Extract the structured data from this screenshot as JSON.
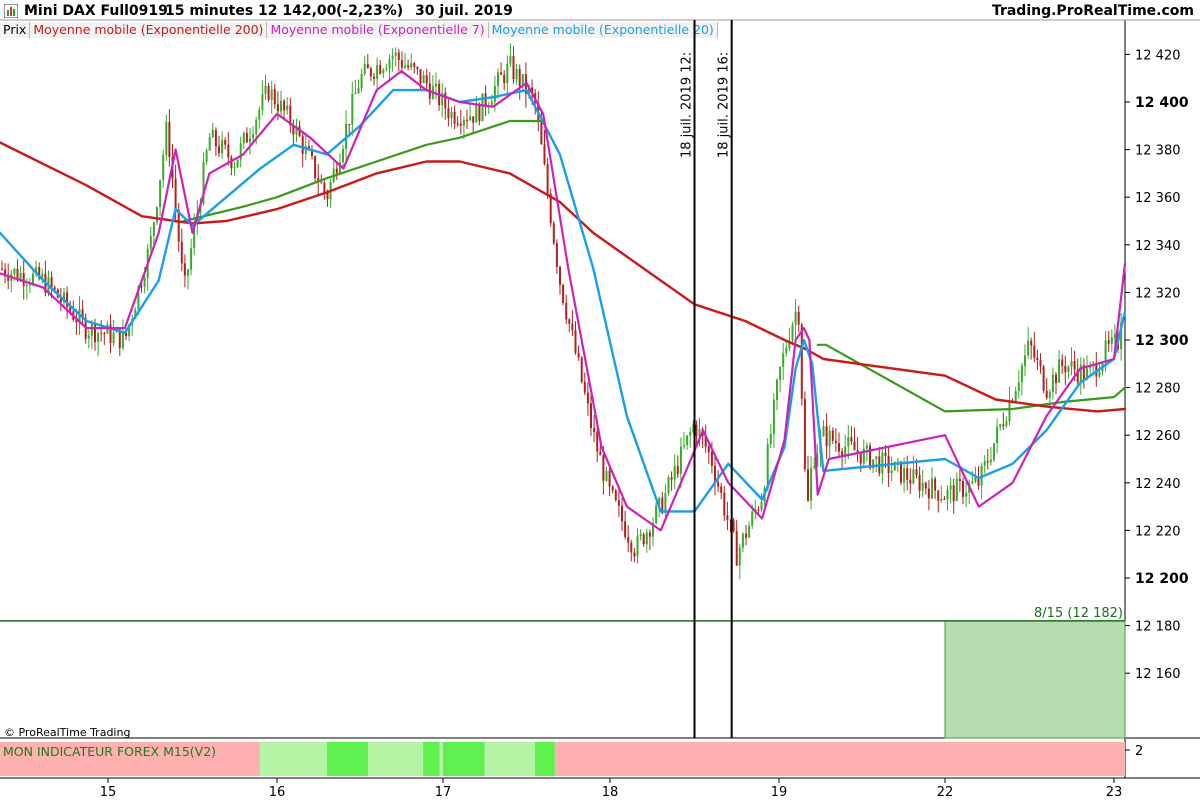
{
  "header": {
    "instrument": "Mini DAX Full0919",
    "timeframe": "15 minutes",
    "price": "12 142,00",
    "change": "(-2,23%)",
    "date": "30 juil. 2019",
    "site": "Trading.ProRealTime.com"
  },
  "legend": {
    "prix": "Prix",
    "ema200": "Moyenne mobile (Exponentielle 200)",
    "ema7": "Moyenne mobile (Exponentielle 7)",
    "ema20": "Moyenne mobile (Exponentielle 20)"
  },
  "copyright": "© ProRealTime Trading",
  "indicator": {
    "label": "MON INDICATEUR FOREX M15(V2)",
    "axis_value": "2",
    "segments": [
      {
        "from": 14.5,
        "to": 15.9,
        "state": "red"
      },
      {
        "from": 15.9,
        "to": 16.3,
        "state": "lightgreen"
      },
      {
        "from": 16.3,
        "to": 16.55,
        "state": "green"
      },
      {
        "from": 16.55,
        "to": 16.88,
        "state": "lightgreen"
      },
      {
        "from": 16.88,
        "to": 16.98,
        "state": "green"
      },
      {
        "from": 16.98,
        "to": 17.0,
        "state": "lightgreen"
      },
      {
        "from": 17.0,
        "to": 17.25,
        "state": "green"
      },
      {
        "from": 17.25,
        "to": 17.55,
        "state": "lightgreen"
      },
      {
        "from": 17.55,
        "to": 17.67,
        "state": "green"
      },
      {
        "from": 17.67,
        "to": 23.1,
        "state": "red"
      }
    ]
  },
  "colors": {
    "ema200": "#c81a1a",
    "ema7": "#cc22bb",
    "ema20": "#1a9ee8",
    "green_line": "#3a9a1a",
    "bull_candle": "#3aaa2a",
    "bear_candle": "#b02020",
    "hline": "#1e6e1e",
    "box": "#b6ddb0",
    "ind_red": "#ffb0b0",
    "ind_light": "#b4f4a4",
    "ind_green": "#60f050"
  },
  "chart_data": {
    "type": "line",
    "title": "Mini DAX Full0919 15 minutes",
    "xlabel": "",
    "ylabel": "",
    "ylim": [
      12128,
      12430
    ],
    "xlim": [
      14.5,
      23.1
    ],
    "x_ticks": [
      15,
      16,
      17,
      18,
      19,
      22,
      23
    ],
    "y_ticks": [
      12160,
      12180,
      12200,
      12220,
      12240,
      12260,
      12280,
      12300,
      12320,
      12340,
      12360,
      12380,
      12400,
      12420
    ],
    "y_tick_labels": [
      "12 160",
      "12 180",
      "12 200",
      "12 220",
      "12 240",
      "12 260",
      "12 280",
      "12 300",
      "12 320",
      "12 340",
      "12 360",
      "12 380",
      "12 400",
      "12 420"
    ],
    "y_bold_ticks": [
      12200,
      12300,
      12400
    ],
    "series": [
      {
        "name": "Prix",
        "x": [
          14.5,
          14.7,
          14.9,
          15.1,
          15.25,
          15.35,
          15.45,
          15.6,
          15.75,
          15.95,
          16.1,
          16.3,
          16.5,
          16.7,
          16.9,
          17.05,
          17.2,
          17.4,
          17.55,
          17.7,
          17.9,
          18.0,
          18.15,
          18.3,
          18.5,
          18.6,
          18.75,
          18.9,
          19.0,
          19.2,
          19.35,
          19.5,
          19.6,
          19.8,
          22.0,
          22.2,
          22.35,
          22.5,
          22.6,
          22.7,
          22.85,
          22.95,
          23.05,
          23.1
        ],
        "close": [
          12330,
          12325,
          12305,
          12300,
          12340,
          12390,
          12320,
          12385,
          12375,
          12405,
          12390,
          12360,
          12410,
          12420,
          12408,
          12395,
          12395,
          12415,
          12400,
          12325,
          12260,
          12235,
          12212,
          12230,
          12265,
          12250,
          12210,
          12235,
          12285,
          12305,
          12315,
          12225,
          12250,
          12260,
          12235,
          12240,
          12268,
          12298,
          12280,
          12290,
          12285,
          12295,
          12300,
          12338
        ]
      },
      {
        "name": "Moyenne mobile (Exponentielle 200)",
        "x": [
          14.5,
          14.9,
          15.2,
          15.5,
          15.7,
          16.0,
          16.3,
          16.6,
          16.9,
          17.1,
          17.4,
          17.7,
          17.9,
          18.2,
          18.5,
          18.8,
          19.1,
          19.5,
          19.8,
          22.0,
          22.3,
          22.6,
          22.9,
          23.1
        ],
        "values": [
          12383,
          12365,
          12352,
          12349,
          12350,
          12355,
          12362,
          12370,
          12375,
          12375,
          12370,
          12358,
          12345,
          12330,
          12315,
          12308,
          12300,
          12296,
          12292,
          12285,
          12275,
          12272,
          12270,
          12271
        ]
      },
      {
        "name": "Moyenne mobile (Exponentielle 7)",
        "x": [
          14.5,
          14.7,
          14.9,
          15.1,
          15.3,
          15.4,
          15.5,
          15.6,
          15.8,
          16.0,
          16.2,
          16.4,
          16.6,
          16.75,
          16.9,
          17.1,
          17.3,
          17.5,
          17.6,
          17.75,
          17.95,
          18.1,
          18.3,
          18.45,
          18.55,
          18.7,
          18.9,
          19.1,
          19.3,
          19.45,
          19.55,
          19.7,
          19.9,
          22.0,
          22.2,
          22.4,
          22.6,
          22.8,
          23.0,
          23.1
        ],
        "values": [
          12328,
          12322,
          12305,
          12305,
          12345,
          12380,
          12345,
          12370,
          12378,
          12395,
          12385,
          12372,
          12405,
          12413,
          12405,
          12400,
          12398,
          12408,
          12395,
          12330,
          12255,
          12230,
          12220,
          12245,
          12262,
          12240,
          12225,
          12258,
          12300,
          12305,
          12300,
          12235,
          12250,
          12260,
          12230,
          12240,
          12268,
          12288,
          12292,
          12332
        ]
      },
      {
        "name": "Moyenne mobile (Exponentielle 20)",
        "x": [
          14.5,
          14.7,
          14.9,
          15.1,
          15.3,
          15.4,
          15.5,
          15.7,
          15.9,
          16.1,
          16.3,
          16.5,
          16.7,
          16.9,
          17.1,
          17.3,
          17.5,
          17.7,
          17.9,
          18.1,
          18.3,
          18.5,
          18.7,
          18.9,
          19.1,
          19.3,
          19.45,
          19.6,
          19.8,
          22.0,
          22.2,
          22.4,
          22.6,
          22.8,
          23.0,
          23.1
        ],
        "values": [
          12345,
          12325,
          12308,
          12303,
          12325,
          12355,
          12348,
          12360,
          12372,
          12382,
          12378,
          12390,
          12405,
          12405,
          12400,
          12402,
          12405,
          12378,
          12330,
          12268,
          12228,
          12228,
          12248,
          12233,
          12255,
          12288,
          12300,
          12290,
          12245,
          12250,
          12242,
          12248,
          12262,
          12282,
          12292,
          12312
        ]
      },
      {
        "name": "",
        "x": [
          15.45,
          15.8,
          16.0,
          16.3,
          16.6,
          16.9,
          17.1,
          17.4,
          17.6
        ],
        "values": [
          12350,
          12356,
          12360,
          12368,
          12375,
          12382,
          12385,
          12392,
          12392
        ],
        "x2": [
          19.7,
          19.85,
          22.0,
          22.4,
          22.7,
          23.0,
          23.1
        ],
        "values2": [
          12298,
          12298,
          12270,
          12271,
          12274,
          12276,
          12280
        ]
      }
    ],
    "vertical_lines": [
      {
        "x": 18.5,
        "label": "18 juil. 2019 12:"
      },
      {
        "x": 18.72,
        "label": "18 juil. 2019 16:"
      }
    ],
    "horizontal_line": {
      "y": 12182,
      "label": "8/15 (12 182)"
    },
    "box": {
      "x_from": 22.0,
      "x_to": 23.1,
      "y_from": 12128,
      "y_to": 12182
    },
    "grid": false,
    "legend_position": "top-left"
  }
}
